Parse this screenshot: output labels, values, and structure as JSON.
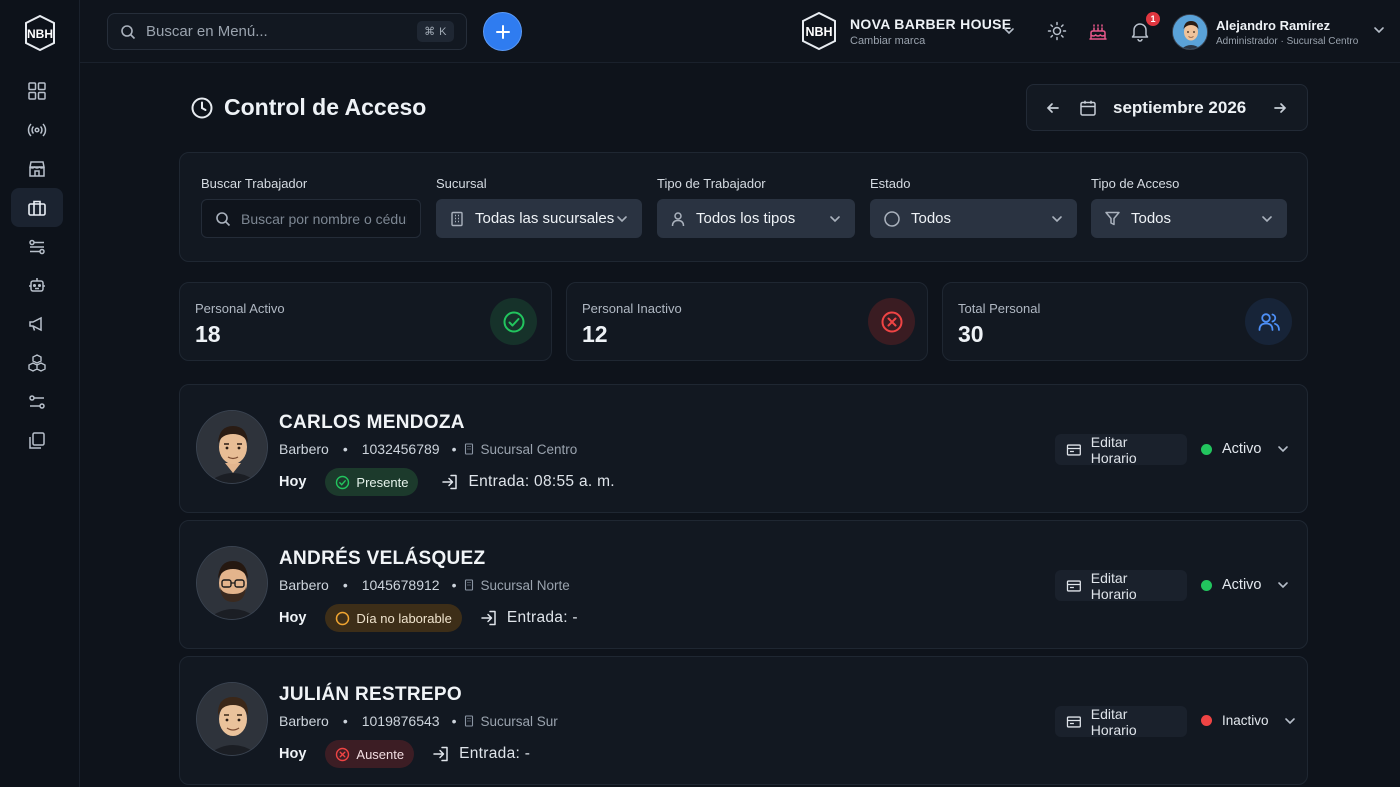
{
  "sidebar": {
    "logo_text": "NBH",
    "items": [
      {
        "icon": "dashboard-icon"
      },
      {
        "icon": "broadcast-icon"
      },
      {
        "icon": "store-icon"
      },
      {
        "icon": "briefcase-icon",
        "active": true
      },
      {
        "icon": "sliders-icon"
      },
      {
        "icon": "robot-icon"
      },
      {
        "icon": "megaphone-icon"
      },
      {
        "icon": "cubes-icon"
      },
      {
        "icon": "filters-icon"
      },
      {
        "icon": "copy-icon"
      }
    ]
  },
  "topbar": {
    "search_placeholder": "Buscar en Menú...",
    "shortcut": "⌘ K",
    "brand": {
      "logo_text": "NBH",
      "name": "NOVA BARBER HOUSE",
      "subtitle": "Cambiar marca"
    },
    "notifications_count": "1",
    "user": {
      "name": "Alejandro Ramírez",
      "role": "Administrador · Sucursal Centro"
    }
  },
  "page": {
    "title": "Control de Acceso",
    "month_label": "septiembre 2026"
  },
  "filters": {
    "search": {
      "label": "Buscar Trabajador",
      "placeholder": "Buscar por nombre o cédula"
    },
    "branch": {
      "label": "Sucursal",
      "value": "Todas las sucursales"
    },
    "worker_type": {
      "label": "Tipo de Trabajador",
      "value": "Todos los tipos"
    },
    "state": {
      "label": "Estado",
      "value": "Todos"
    },
    "access_type": {
      "label": "Tipo de Acceso",
      "value": "Todos"
    }
  },
  "stats": [
    {
      "label": "Personal Activo",
      "value": "18",
      "color": "#22c55e"
    },
    {
      "label": "Personal Inactivo",
      "value": "12",
      "color": "#ef4444"
    },
    {
      "label": "Total Personal",
      "value": "30",
      "color": "#3b82f6"
    }
  ],
  "workers": [
    {
      "name": "CARLOS MENDOZA",
      "role": "Barbero",
      "id": "1032456789",
      "branch": "Sucursal Centro",
      "today_label": "Hoy",
      "attendance": "Presente",
      "entry": "Entrada: 08:55 a. m.",
      "edit_label": "Editar Horario",
      "status": "Activo",
      "status_color": "#22c55e"
    },
    {
      "name": "ANDRÉS VELÁSQUEZ",
      "role": "Barbero",
      "id": "1045678912",
      "branch": "Sucursal Norte",
      "today_label": "Hoy",
      "attendance": "Día no laborable",
      "entry": "Entrada: -",
      "edit_label": "Editar Horario",
      "status": "Activo",
      "status_color": "#22c55e"
    },
    {
      "name": "JULIÁN RESTREPO",
      "role": "Barbero",
      "id": "1019876543",
      "branch": "Sucursal Sur",
      "today_label": "Hoy",
      "attendance": "Ausente",
      "entry": "Entrada: -",
      "edit_label": "Editar Horario",
      "status": "Inactivo",
      "status_color": "#ef4444"
    }
  ]
}
